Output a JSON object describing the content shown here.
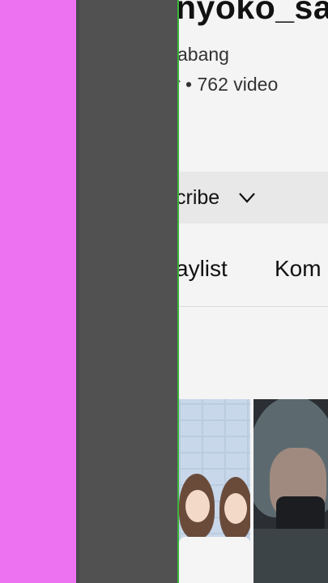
{
  "channel": {
    "name": "nyoko_sa",
    "handle": "abang",
    "stats": "r • 762 video"
  },
  "subscribe": {
    "label": "cribe",
    "icon": "chevron-down-icon"
  },
  "tabs": [
    {
      "label": "aylist"
    },
    {
      "label": "Kom"
    }
  ],
  "colors": {
    "left_strip": "#ec72f2",
    "gray_strip": "#525152",
    "divider": "#3db33d",
    "app_background": "#f4f4f4"
  }
}
